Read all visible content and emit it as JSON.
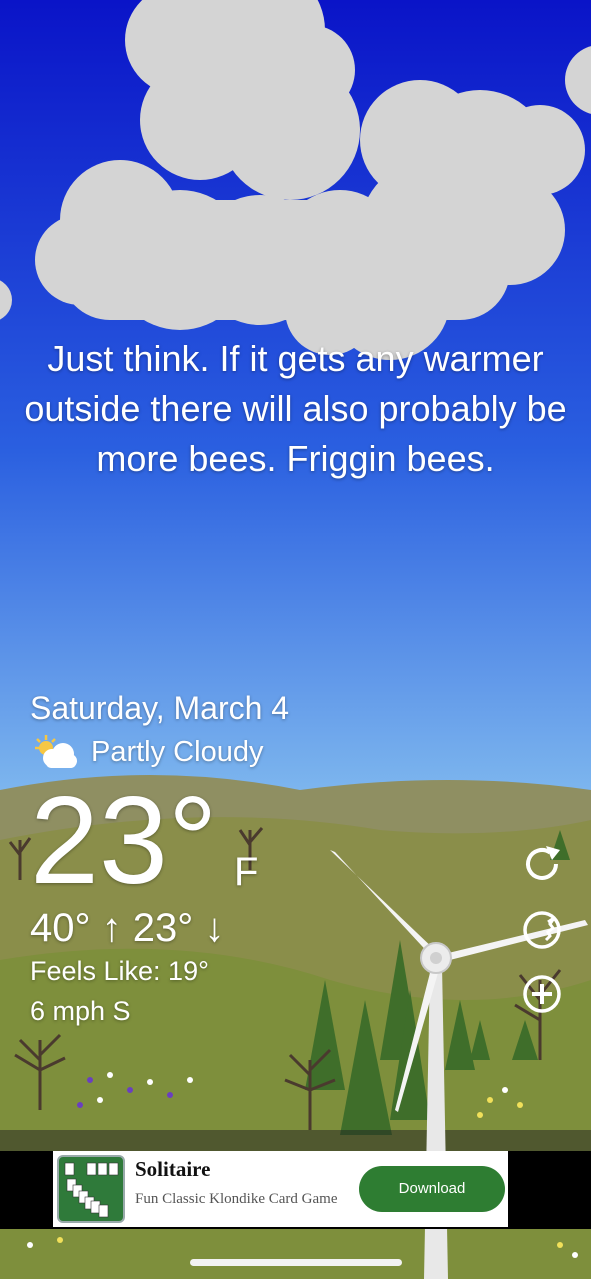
{
  "quote": "Just think. If it gets any warmer outside there will also probably be more bees. Friggin bees.",
  "weather": {
    "date": "Saturday, March 4",
    "condition": "Partly Cloudy",
    "condition_icon": "partly-cloudy-icon",
    "temperature": "23°",
    "unit": "F",
    "high_low": "40° ↑ 23° ↓",
    "feels_like": "Feels Like: 19°",
    "wind": "6 mph S"
  },
  "side_buttons": [
    {
      "icon": "refresh-icon"
    },
    {
      "icon": "location-icon"
    },
    {
      "icon": "add-icon"
    }
  ],
  "ad": {
    "title": "Solitaire",
    "subtitle": "Fun Classic Klondike Card Game",
    "button": "Download"
  },
  "colors": {
    "sky_top": "#0a14c8",
    "sky_bottom": "#7db6ee",
    "hills": "#7a8a3a",
    "ad_button": "#2e7d32"
  }
}
